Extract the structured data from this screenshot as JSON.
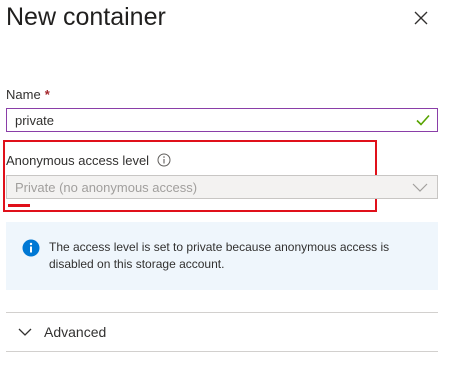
{
  "panel": {
    "title": "New container",
    "close_icon": "close-icon"
  },
  "name_field": {
    "label": "Name",
    "required_marker": "*",
    "value": "private",
    "status_icon": "checkmark-icon",
    "border_color": "#8a3ea8",
    "valid_color": "#57a300"
  },
  "access_level": {
    "label": "Anonymous access level",
    "info_icon": "info-circle-icon",
    "value": "Private (no anonymous access)",
    "disabled": true,
    "dropdown_icon": "chevron-down-icon"
  },
  "annotation": {
    "color": "#e0101a"
  },
  "info_banner": {
    "icon": "info-icon",
    "text": "The access level is set to private because anonymous access is disabled on this storage account.",
    "background": "#eff6fc",
    "icon_color": "#0078d4"
  },
  "advanced": {
    "label": "Advanced",
    "icon": "chevron-down-icon"
  }
}
